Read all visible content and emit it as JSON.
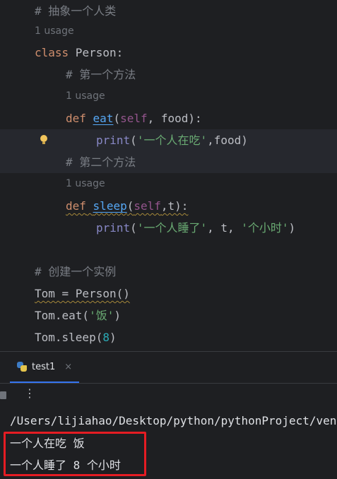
{
  "editor": {
    "lines": {
      "l1_comment": "# 抽象一个人类",
      "l2_hint": "1 usage",
      "l3_kw": "class",
      "l3_name": " Person:",
      "l4_comment": "# 第一个方法",
      "l5_hint": "1 usage",
      "l6_def": "def",
      "l6_sp": " ",
      "l6_fn": "eat",
      "l6_p1": "(",
      "l6_self": "self",
      "l6_rest": ", food):",
      "l7_print": "print",
      "l7_p": "(",
      "l7_str": "'一个人在吃'",
      "l7_rest": ",food)",
      "l8_comment": "# 第二个方法",
      "l9_hint": "1 usage",
      "l10_def": "def",
      "l10_sp": " ",
      "l10_fn": "sleep",
      "l10_p1": "(",
      "l10_self": "self",
      "l10_rest": ",t):",
      "l11_print": "print",
      "l11_p": "(",
      "l11_str1": "'一个人睡了'",
      "l11_mid": ", t, ",
      "l11_str2": "'个小时'",
      "l11_end": ")",
      "l13_comment": "# 创建一个实例",
      "l14_code": "Tom = Person()",
      "l15_pre": "Tom.eat(",
      "l15_str": "'饭'",
      "l15_end": ")",
      "l16_pre": "Tom.sleep(",
      "l16_num": "8",
      "l16_end": ")"
    }
  },
  "run_panel": {
    "tab_label": "test1",
    "close_glyph": "×",
    "more_glyph": "⋮",
    "output": [
      "/Users/lijiahao/Desktop/python/pythonProject/venv/bin/python",
      "一个人在吃 饭",
      "一个人睡了 8 个小时"
    ]
  },
  "colors": {
    "background": "#1e1f22",
    "keyword": "#cf8e6d",
    "function": "#56a8f5",
    "string": "#6aab73",
    "number": "#2aacb8",
    "self": "#94558d",
    "comment": "#7a7e85",
    "highlight_box": "#e51c23"
  },
  "icons": [
    "lightbulb-icon",
    "python-file-icon",
    "close-icon",
    "stop-icon",
    "more-options-icon"
  ]
}
